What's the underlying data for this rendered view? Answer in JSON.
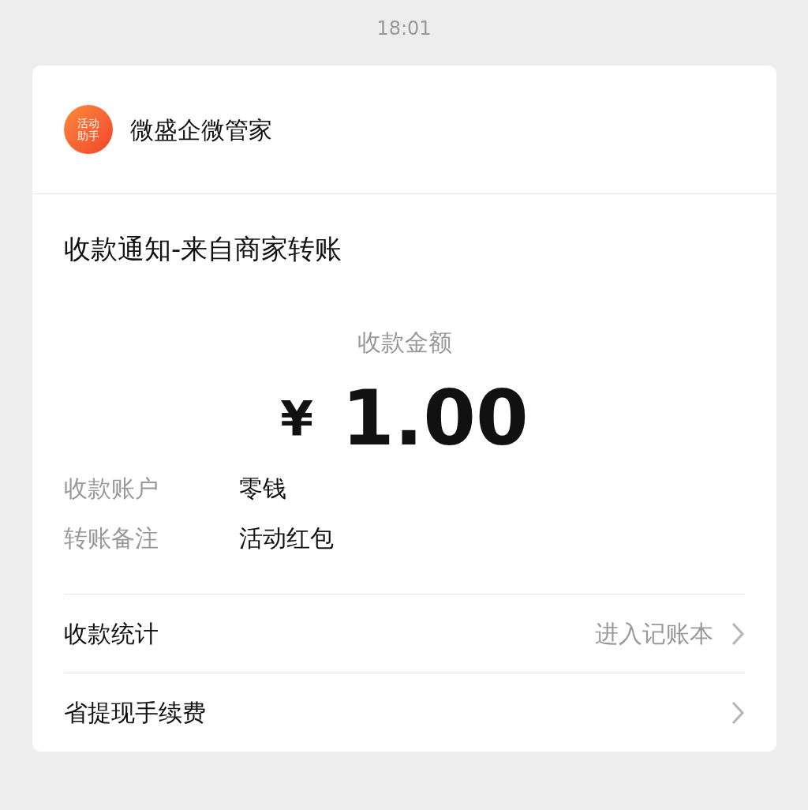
{
  "status_bar": {
    "time": "18:01"
  },
  "sender": {
    "avatar_text": "活动助手",
    "name": "微盛企微管家"
  },
  "message": {
    "title": "收款通知-来自商家转账",
    "amount_label": "收款金额",
    "currency": "¥",
    "amount": "1.00",
    "details": [
      {
        "label": "收款账户",
        "value": "零钱"
      },
      {
        "label": "转账备注",
        "value": "活动红包"
      }
    ],
    "links": [
      {
        "label": "收款统计",
        "hint": "进入记账本"
      },
      {
        "label": "省提现手续费"
      }
    ]
  }
}
